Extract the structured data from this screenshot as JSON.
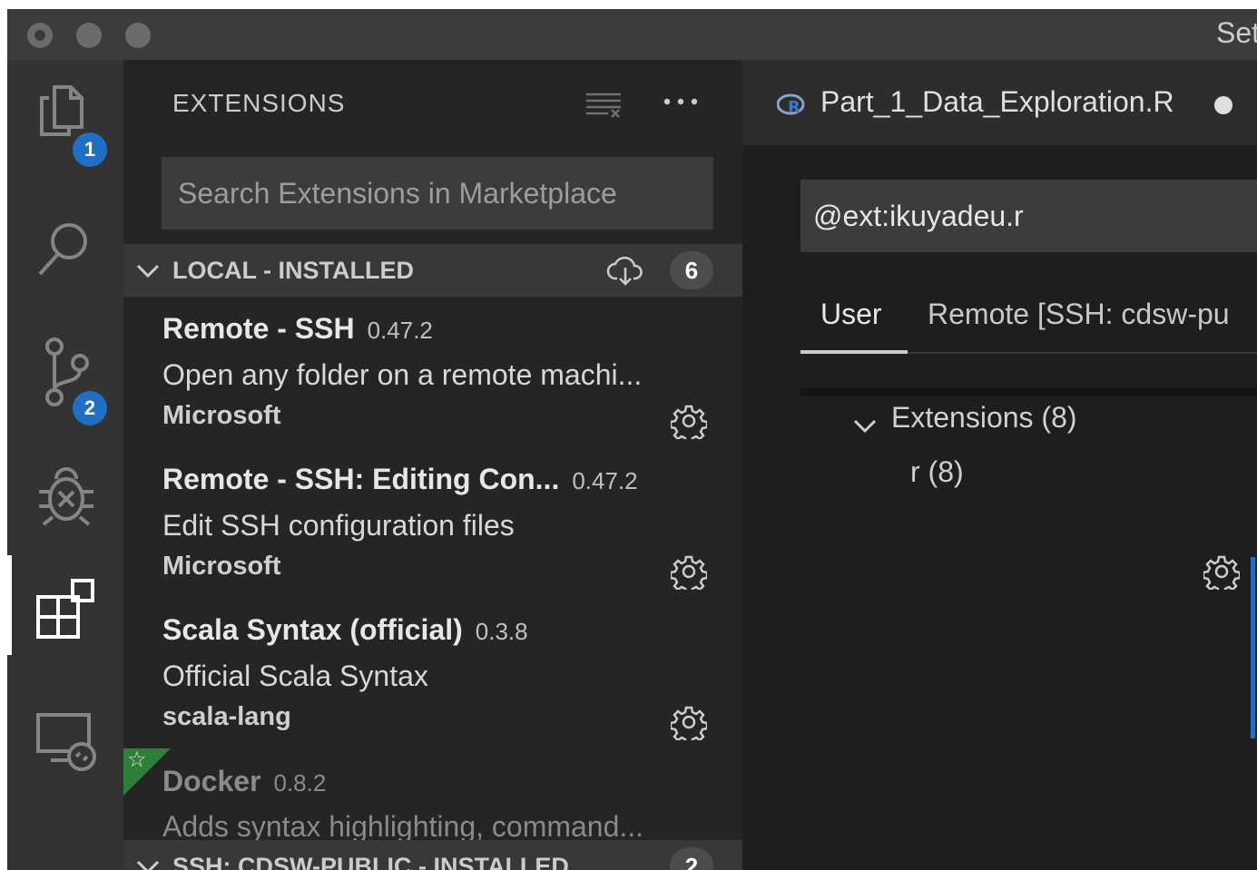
{
  "window": {
    "title": "Set"
  },
  "activity_bar": {
    "explorer_badge": "1",
    "scm_badge": "2"
  },
  "sidebar": {
    "title": "EXTENSIONS",
    "search_placeholder": "Search Extensions in Marketplace",
    "local_section": {
      "label": "LOCAL - INSTALLED",
      "count": "6"
    },
    "extensions": [
      {
        "name": "Remote - SSH",
        "version": "0.47.2",
        "description": "Open any folder on a remote machi...",
        "publisher": "Microsoft"
      },
      {
        "name": "Remote - SSH: Editing Con...",
        "version": "0.47.2",
        "description": "Edit SSH configuration files",
        "publisher": "Microsoft"
      },
      {
        "name": "Scala Syntax (official)",
        "version": "0.3.8",
        "description": "Official Scala Syntax",
        "publisher": "scala-lang"
      },
      {
        "name": "Docker",
        "version": "0.8.2",
        "description": "Adds syntax highlighting, command...",
        "publisher": ""
      }
    ],
    "ssh_section": {
      "label": "SSH: CDSW-PUBLIC - INSTALLED",
      "count": "2"
    }
  },
  "editor": {
    "tab_label": "Part_1_Data_Exploration.R",
    "settings_search_value": "@ext:ikuyadeu.r",
    "tabs": {
      "user": "User",
      "remote": "Remote [SSH: cdsw-pu"
    },
    "tree": {
      "extensions": "Extensions (8)",
      "r": "r (8)"
    }
  }
}
